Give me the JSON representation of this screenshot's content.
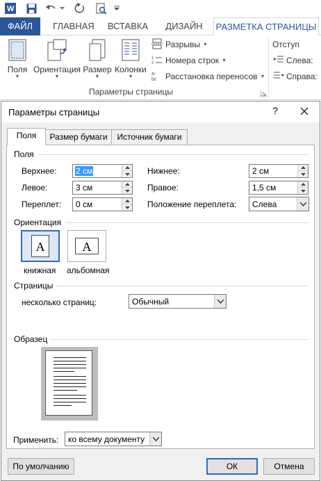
{
  "ribbon": {
    "tabs": [
      "ФАЙЛ",
      "ГЛАВНАЯ",
      "ВСТАВКА",
      "ДИЗАЙН",
      "РАЗМЕТКА СТРАНИЦЫ"
    ],
    "buttons": [
      "Поля",
      "Ориентация",
      "Размер",
      "Колонки"
    ],
    "small_buttons": [
      "Разрывы",
      "Номера строк",
      "Расстановка переносов"
    ],
    "group_label": "Параметры страницы",
    "indent_title": "Отступ",
    "indent_left": "Слева:",
    "indent_right": "Справа:"
  },
  "dialog": {
    "title": "Параметры страницы",
    "help": "?",
    "tabs": [
      "Поля",
      "Размер бумаги",
      "Источник бумаги"
    ],
    "margins": {
      "section": "Поля",
      "top_label": "Верхнее:",
      "top_value": "2 см",
      "bottom_label": "Нижнее:",
      "bottom_value": "2 см",
      "left_label": "Левое:",
      "left_value": "3 см",
      "right_label": "Правое:",
      "right_value": "1,5 см",
      "gutter_label": "Переплет:",
      "gutter_value": "0 см",
      "gutter_pos_label": "Положение переплета:",
      "gutter_pos_value": "Слева"
    },
    "orientation": {
      "section": "Ориентация",
      "portrait": "книжная",
      "landscape": "альбомная",
      "glyph": "A"
    },
    "pages": {
      "section": "Страницы",
      "multiple_label": "несколько страниц:",
      "multiple_value": "Обычный"
    },
    "preview": {
      "section": "Образец"
    },
    "apply": {
      "label": "Применить:",
      "value": "ко всему документу"
    },
    "buttons": {
      "default": "По умолчанию",
      "ok": "ОК",
      "cancel": "Отмена"
    }
  }
}
